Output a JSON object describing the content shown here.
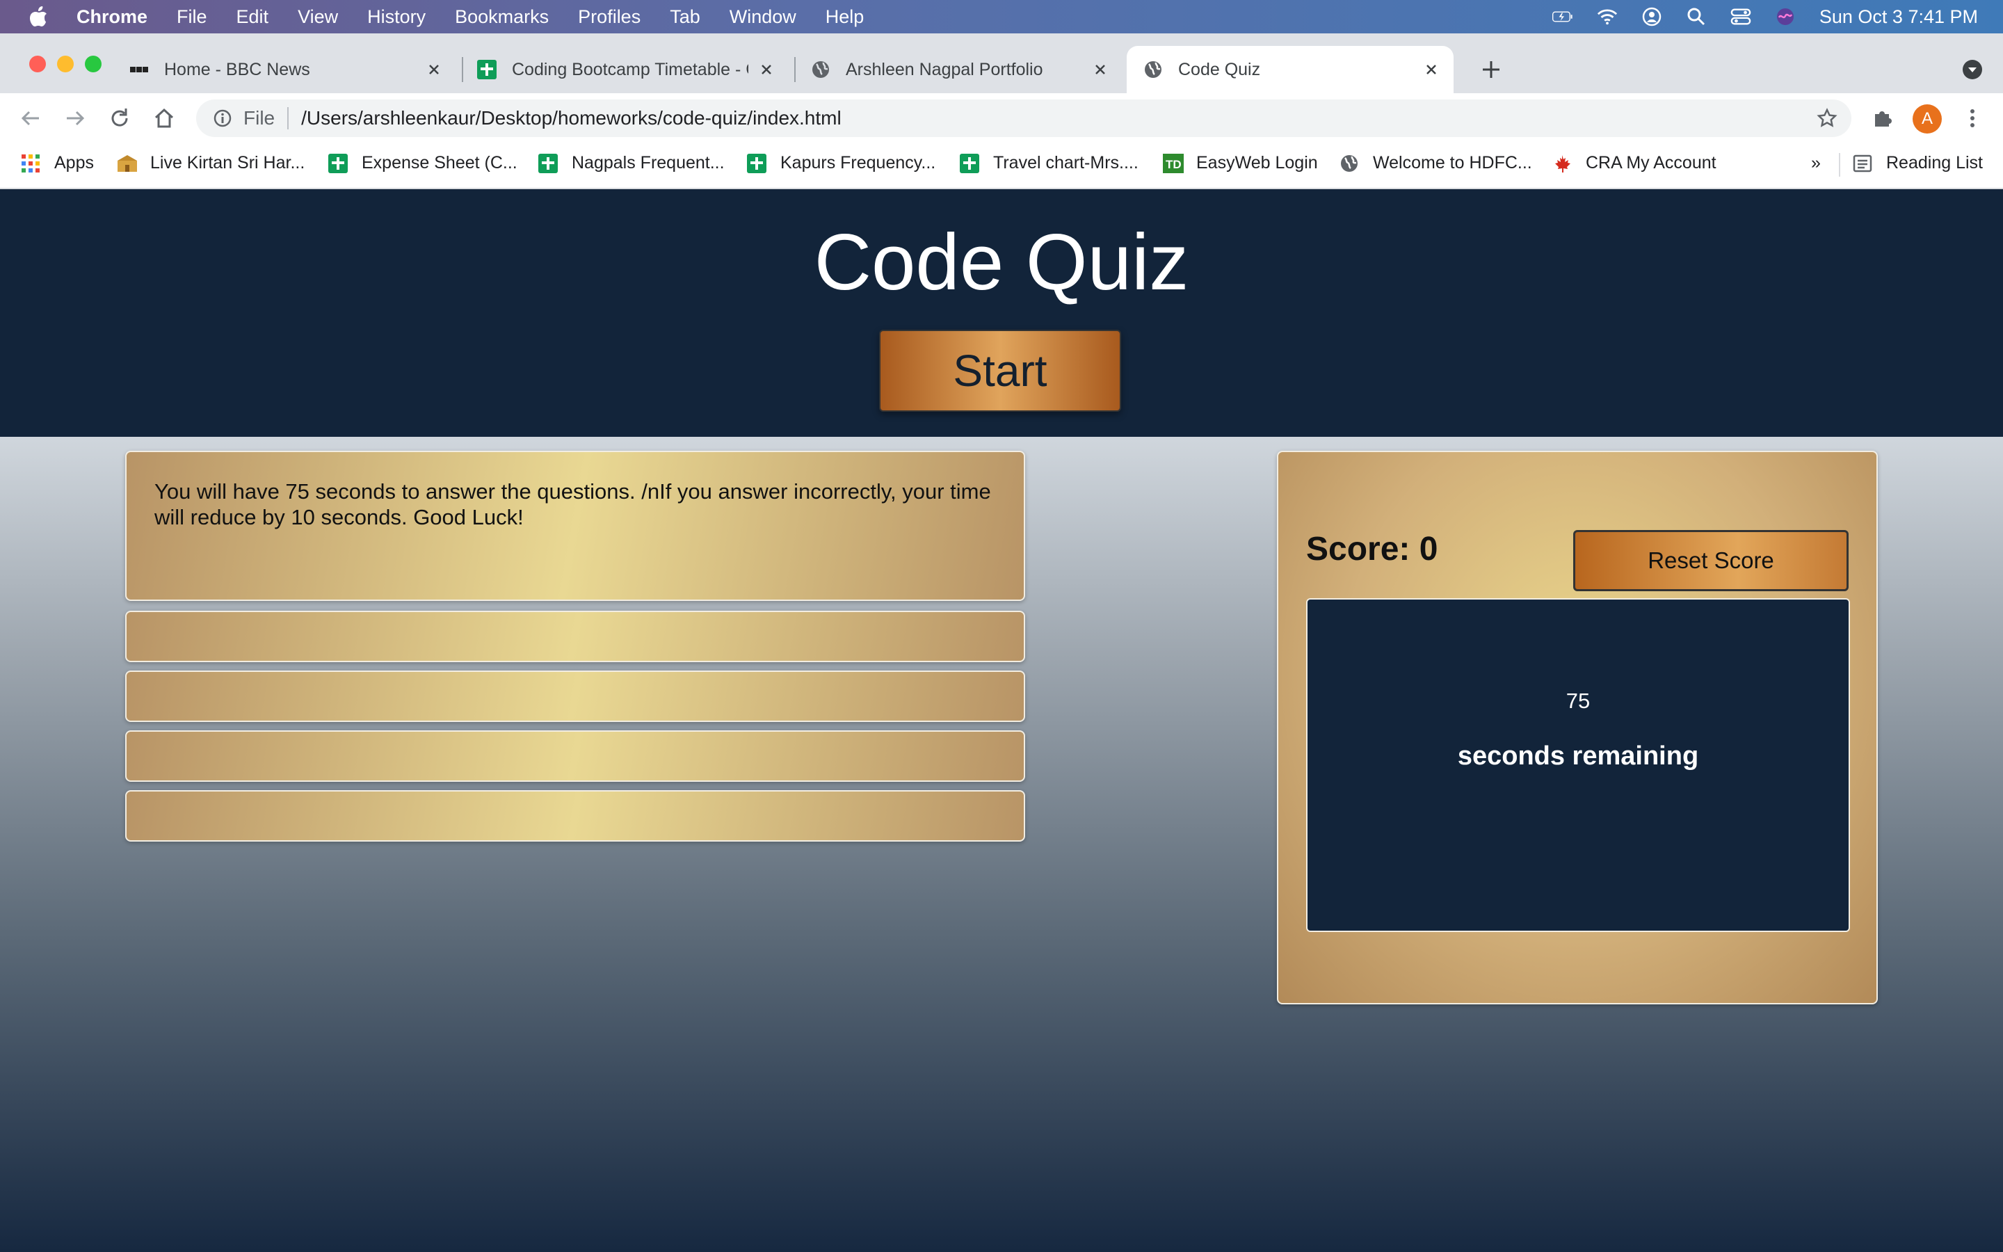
{
  "menubar": {
    "app": "Chrome",
    "items": [
      "File",
      "Edit",
      "View",
      "History",
      "Bookmarks",
      "Profiles",
      "Tab",
      "Window",
      "Help"
    ],
    "clock": "Sun Oct 3  7:41 PM"
  },
  "tabs": [
    {
      "label": "Home - BBC News",
      "icon": "bbc-icon"
    },
    {
      "label": "Coding Bootcamp Timetable - G",
      "icon": "sheets-icon"
    },
    {
      "label": "Arshleen Nagpal Portfolio",
      "icon": "globe-icon"
    },
    {
      "label": "Code Quiz",
      "icon": "globe-icon",
      "active": true
    }
  ],
  "address": {
    "scheme": "File",
    "url": "/Users/arshleenkaur/Desktop/homeworks/code-quiz/index.html"
  },
  "profile_initial": "A",
  "bookmarks": [
    {
      "label": "Apps",
      "icon": "apps-grid-icon"
    },
    {
      "label": "Live Kirtan Sri Har...",
      "icon": "temple-icon"
    },
    {
      "label": "Expense Sheet (C...",
      "icon": "sheets-icon"
    },
    {
      "label": "Nagpals Frequent...",
      "icon": "sheets-icon"
    },
    {
      "label": "Kapurs Frequency...",
      "icon": "sheets-icon"
    },
    {
      "label": "Travel chart-Mrs....",
      "icon": "sheets-icon"
    },
    {
      "label": "EasyWeb Login",
      "icon": "td-icon"
    },
    {
      "label": "Welcome to HDFC...",
      "icon": "globe-icon"
    },
    {
      "label": "CRA My Account",
      "icon": "maple-leaf-icon"
    }
  ],
  "bookmarks_overflow": "»",
  "reading_list": "Reading List",
  "quiz": {
    "title": "Code Quiz",
    "start_label": "Start",
    "question_text": "You will have 75 seconds to answer the questions. /nIf you answer incorrectly, your time will reduce by 10 seconds. Good Luck!",
    "answers": [
      "",
      "",
      "",
      ""
    ],
    "score_label": "Score: 0",
    "reset_label": "Reset Score",
    "timer_value": "75",
    "timer_text": "seconds remaining"
  },
  "colors": {
    "header_navy": "#12243a",
    "gold_light": "#e9d893",
    "gold_dark": "#b89466",
    "button_copper": "#b8661e"
  }
}
